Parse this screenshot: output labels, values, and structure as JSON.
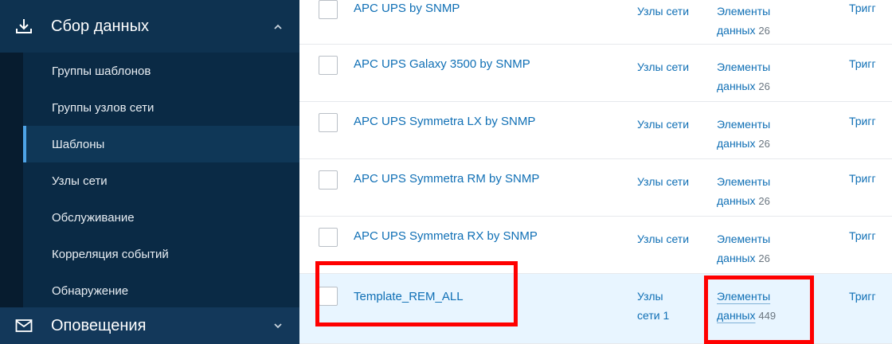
{
  "sidebar": {
    "section_top": {
      "label": "Сбор данных",
      "icon": "download-icon"
    },
    "items": [
      {
        "label": "Группы шаблонов"
      },
      {
        "label": "Группы узлов сети"
      },
      {
        "label": "Шаблоны",
        "active": true
      },
      {
        "label": "Узлы сети"
      },
      {
        "label": "Обслуживание"
      },
      {
        "label": "Корреляция событий"
      },
      {
        "label": "Обнаружение"
      }
    ],
    "section_bottom": {
      "label": "Оповещения",
      "icon": "envelope-icon"
    }
  },
  "table": {
    "rows": [
      {
        "name": "APC UPS by SNMP",
        "hosts": "Узлы сети",
        "items_word1": "Элементы",
        "items_word2": "данных",
        "items_count": "26",
        "triggers": "Тригг"
      },
      {
        "name": "APC UPS Galaxy 3500 by SNMP",
        "hosts": "Узлы сети",
        "items_word1": "Элементы",
        "items_word2": "данных",
        "items_count": "26",
        "triggers": "Тригг"
      },
      {
        "name": "APC UPS Symmetra LX by SNMP",
        "hosts": "Узлы сети",
        "items_word1": "Элементы",
        "items_word2": "данных",
        "items_count": "26",
        "triggers": "Тригг"
      },
      {
        "name": "APC UPS Symmetra RM by SNMP",
        "hosts": "Узлы сети",
        "items_word1": "Элементы",
        "items_word2": "данных",
        "items_count": "26",
        "triggers": "Тригг"
      },
      {
        "name": "APC UPS Symmetra RX by SNMP",
        "hosts": "Узлы сети",
        "items_word1": "Элементы",
        "items_word2": "данных",
        "items_count": "26",
        "triggers": "Тригг"
      },
      {
        "name": "Template_REM_ALL",
        "hosts_line1": "Узлы",
        "hosts_line2": "сети 1",
        "items_word1": "Элементы",
        "items_word2": "данных",
        "items_count": "449",
        "triggers": "Тригг",
        "highlighted": true
      }
    ]
  },
  "colors": {
    "sidebar_bg": "#0e3250",
    "link": "#0f6fb5",
    "highlight_row": "#e8f5ff",
    "annotation": "#ff0000"
  }
}
